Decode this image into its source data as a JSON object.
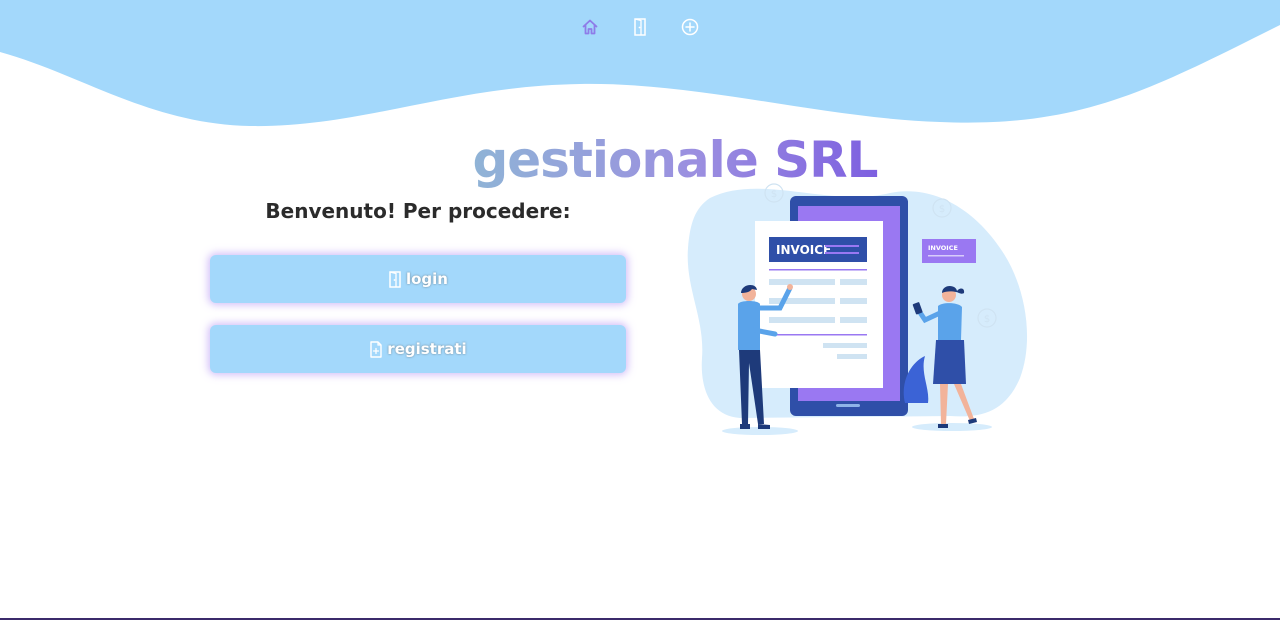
{
  "nav": {
    "items": [
      {
        "icon": "home-icon",
        "color": "#8e7ce8"
      },
      {
        "icon": "door-icon",
        "color": "#ffffff"
      },
      {
        "icon": "plus-circle-icon",
        "color": "#ffffff"
      }
    ]
  },
  "brand": {
    "title": "gestionale SRL"
  },
  "welcome": {
    "text": "Benvenuto! Per procedere:"
  },
  "actions": {
    "login_label": "login",
    "register_label": "registrati"
  },
  "illustration": {
    "invoice_label": "INVOICE",
    "small_invoice_label": "INVOICE",
    "dollar_symbol": "$"
  },
  "colors": {
    "wave": "#a3d8fb",
    "button": "#a3d8fb",
    "button_glow": "#c4aaf5",
    "brand_start": "#8fb4d6",
    "brand_end": "#7d5fe0",
    "text": "#2b2b2b"
  }
}
